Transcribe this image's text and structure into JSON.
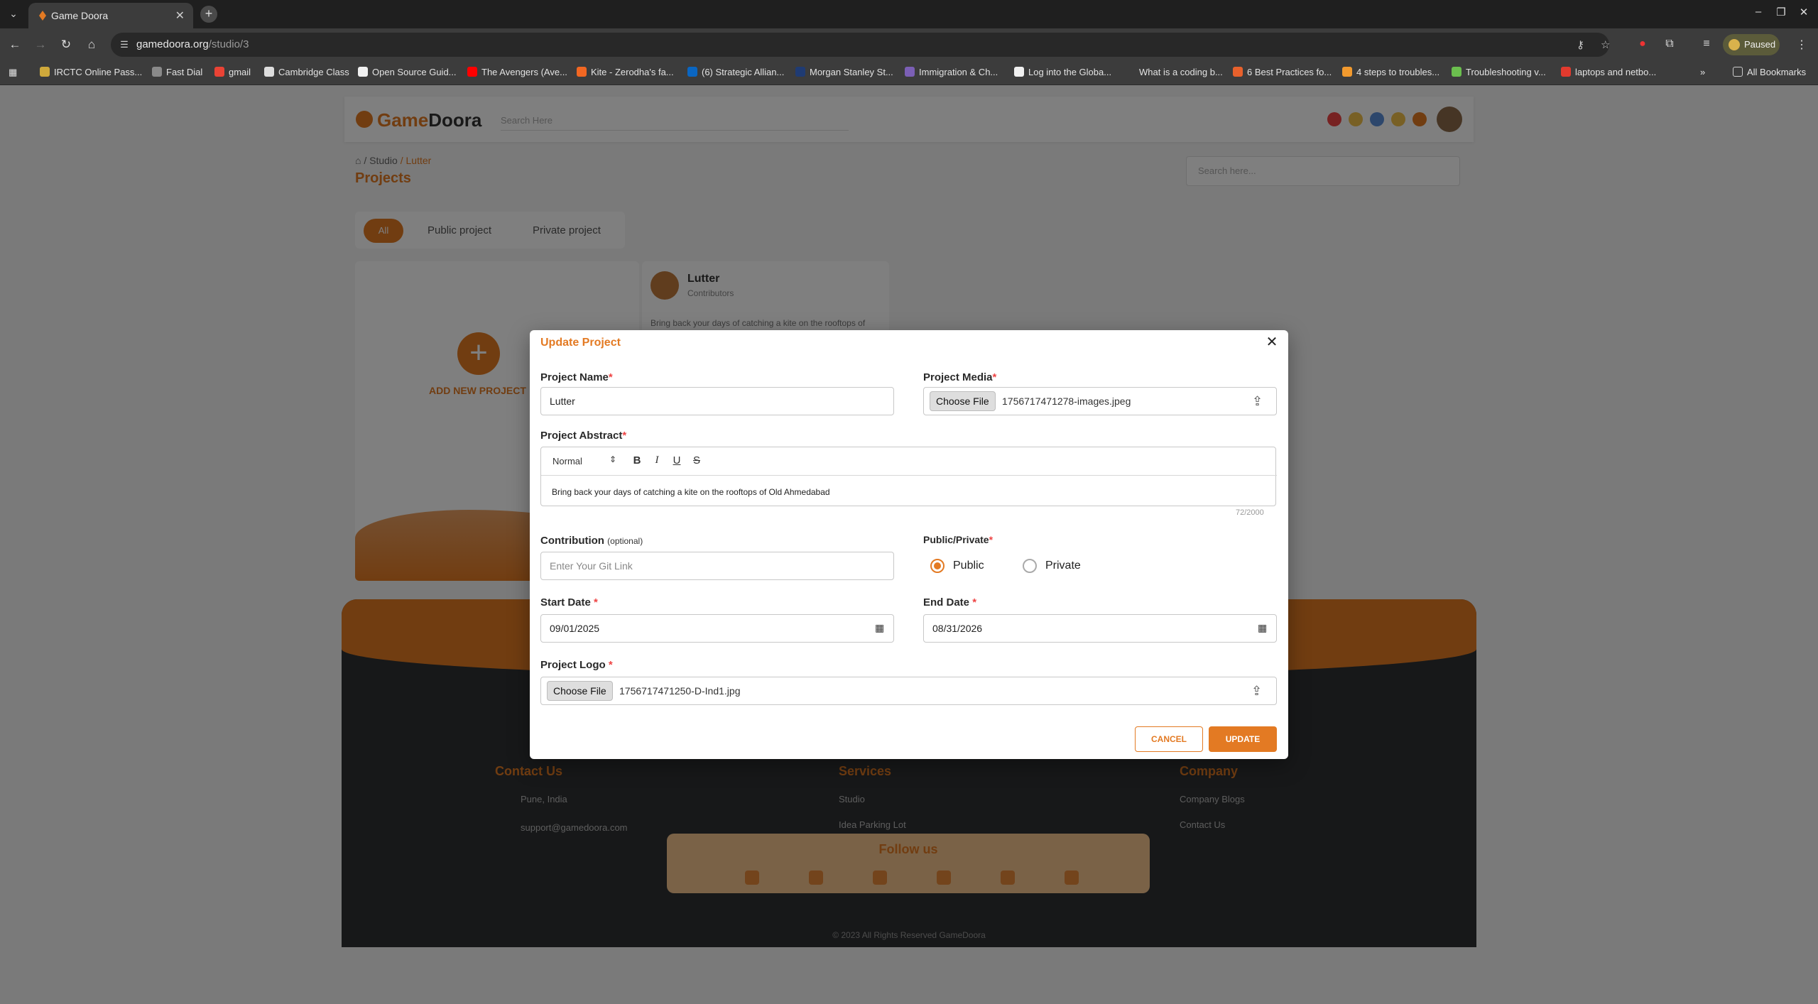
{
  "browser": {
    "tab_title": "Game Doora",
    "url_host": "gamedoora.org",
    "url_path": "/studio/3",
    "paused_label": "Paused",
    "all_bookmarks": "All Bookmarks",
    "bookmarks": [
      {
        "label": "IRCTC Online Pass...",
        "icon_color": "#cfa93b"
      },
      {
        "label": "Fast Dial",
        "icon_color": "#8a8a8a"
      },
      {
        "label": "gmail",
        "icon_color": "#ea4335"
      },
      {
        "label": "Cambridge Class",
        "icon_color": "#dddddd"
      },
      {
        "label": "Open Source Guid...",
        "icon_color": "#f0f0f0"
      },
      {
        "label": "The Avengers (Ave...",
        "icon_color": "#ff0000"
      },
      {
        "label": "Kite - Zerodha's fa...",
        "icon_color": "#f26722"
      },
      {
        "label": "(6) Strategic Allian...",
        "icon_color": "#0a66c2"
      },
      {
        "label": "Morgan Stanley St...",
        "icon_color": "#1f3b73"
      },
      {
        "label": "Immigration & Ch...",
        "icon_color": "#7b5fb5"
      },
      {
        "label": "Log into the Globa...",
        "icon_color": "#f0f0f0"
      },
      {
        "label": "What is a coding b...",
        "icon_color": "#3c3c3c"
      },
      {
        "label": "6 Best Practices fo...",
        "icon_color": "#e8612c"
      },
      {
        "label": "4 steps to troubles...",
        "icon_color": "#f29a2e"
      },
      {
        "label": "Troubleshooting v...",
        "icon_color": "#6bbf4e"
      },
      {
        "label": "laptops and netbo...",
        "icon_color": "#e23a2e"
      }
    ]
  },
  "background_page": {
    "logo_text_a": "Game",
    "logo_text_b": "Doora",
    "search_placeholder": "Search Here",
    "breadcrumb_studio": "Studio",
    "breadcrumb_current": "/ Lutter",
    "title": "Projects",
    "page_search_placeholder": "Search here...",
    "filters": [
      "All",
      "Public project",
      "Private project"
    ],
    "add_new_label": "ADD NEW PROJECT",
    "card_name": "Lutter",
    "card_sub": "Contributors",
    "card_text": "Bring back your days of catching a kite on the rooftops of",
    "footer": {
      "contact_heading": "Contact Us",
      "contact_location": "Pune, India",
      "contact_email": "support@gamedoora.com",
      "services_heading": "Services",
      "services_items": [
        "Studio",
        "Idea Parking Lot"
      ],
      "company_heading": "Company",
      "company_items": [
        "Company Blogs",
        "Contact Us"
      ],
      "follow_heading": "Follow us",
      "copyright": "© 2023 All Rights Reserved GameDoora"
    }
  },
  "modal": {
    "title": "Update Project",
    "project_name_label": "Project Name",
    "project_name_value": "Lutter",
    "project_media_label": "Project Media",
    "choose_file_label": "Choose File",
    "media_file_name": "1756717471278-images.jpeg",
    "abstract_label": "Project Abstract",
    "editor_format": "Normal",
    "abstract_text": "Bring back your days of catching a kite on the rooftops of Old Ahmedabad",
    "char_counter": "72/2000",
    "contribution_label": "Contribution",
    "contribution_optional": "(optional)",
    "contribution_placeholder": "Enter Your Git Link",
    "visibility_label": "Public/Private",
    "public_label": "Public",
    "private_label": "Private",
    "selected_visibility": "Public",
    "start_date_label": "Start Date",
    "start_date_value": "09/01/2025",
    "end_date_label": "End Date",
    "end_date_value": "08/31/2026",
    "project_logo_label": "Project Logo",
    "logo_file_name": "1756717471250-D-Ind1.jpg",
    "cancel_label": "CANCEL",
    "update_label": "UPDATE",
    "accent_color": "#e37a23",
    "required_marker": "*"
  }
}
